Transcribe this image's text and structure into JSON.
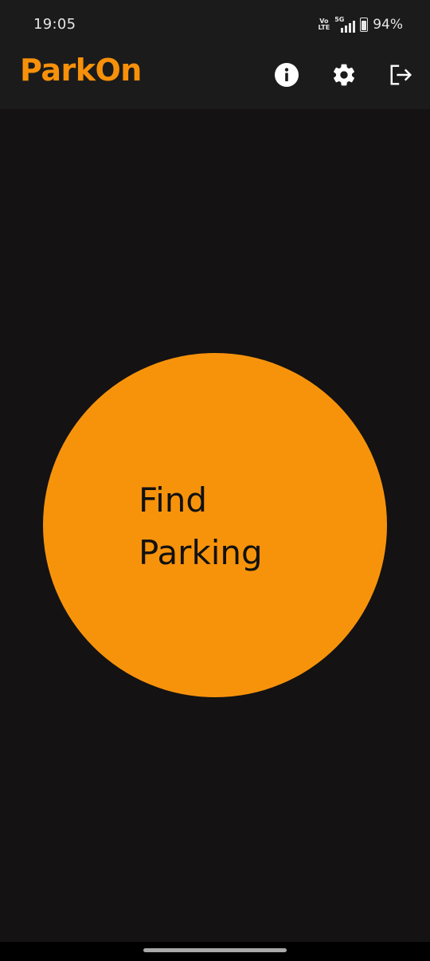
{
  "status_bar": {
    "time": "19:05",
    "volte_top": "Vo",
    "volte_bottom": "LTE",
    "network": "5G",
    "battery": "94%"
  },
  "app_bar": {
    "title": "ParkOn",
    "title_color": "#f7910a",
    "actions": [
      {
        "icon": "info-icon"
      },
      {
        "icon": "gear-icon"
      },
      {
        "icon": "logout-icon"
      }
    ]
  },
  "main": {
    "find_button": {
      "label": "Find\nParking",
      "color": "#f7930b"
    }
  },
  "colors": {
    "background": "#141213",
    "bar": "#1c1b1b",
    "accent": "#f7910a"
  }
}
